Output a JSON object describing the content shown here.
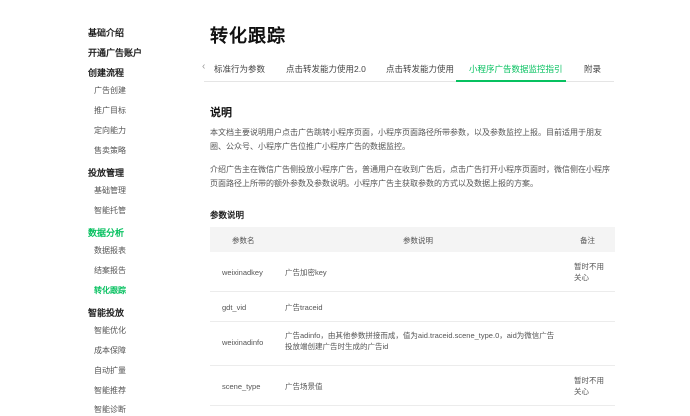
{
  "sidebar": {
    "groups": [
      {
        "head": "基础介绍",
        "items": []
      },
      {
        "head": "开通广告账户",
        "items": []
      },
      {
        "head": "创建流程",
        "items": [
          "广告创建",
          "推广目标",
          "定向能力",
          "售卖策略"
        ]
      },
      {
        "head": "投放管理",
        "items": [
          "基础管理",
          "智能托管"
        ]
      },
      {
        "head": "数据分析",
        "items": [
          "数据报表",
          "结案报告",
          "转化跟踪"
        ]
      },
      {
        "head": "智能投放",
        "items": [
          "智能优化",
          "成本保障",
          "自动扩量",
          "智能推荐",
          "智能诊断"
        ]
      }
    ],
    "active_group": "数据分析",
    "active_item": "转化跟踪"
  },
  "main": {
    "title": "转化跟踪",
    "tabs": [
      "标准行为参数",
      "点击转发能力使用2.0",
      "点击转发能力使用",
      "小程序广告数据监控指引",
      "附录"
    ],
    "active_tab": "小程序广告数据监控指引",
    "section_title": "说明",
    "para1": "本文档主要说明用户点击广告跳转小程序页面，小程序页面路径所带参数，以及参数监控上报。目前适用于朋友圈、公众号、小程序广告位推广小程序广告的数据监控。",
    "para2": "介绍广告主在微信广告侧投放小程序广告，普通用户在收到广告后，点击广告打开小程序页面时，微信侧在小程序页面路径上所带的额外参数及参数说明。小程序广告主获取参数的方式以及数据上报的方案。",
    "params_title": "参数说明",
    "table": {
      "headers": [
        "参数名",
        "参数说明",
        "备注"
      ],
      "rows": [
        {
          "name": "weixinadkey",
          "desc": "广告加密key",
          "note": "暂时不用关心"
        },
        {
          "name": "gdt_vid",
          "desc": "广告traceid",
          "note": ""
        },
        {
          "name": "weixinadinfo",
          "desc": "广告adinfo，由其他参数拼接而成，值为aid.traceid.scene_type.0，aid为微信广告投放端创建广告时生成的广告id",
          "note": ""
        },
        {
          "name": "scene_type",
          "desc": "广告场景值",
          "note": "暂时不用关心"
        }
      ]
    }
  }
}
